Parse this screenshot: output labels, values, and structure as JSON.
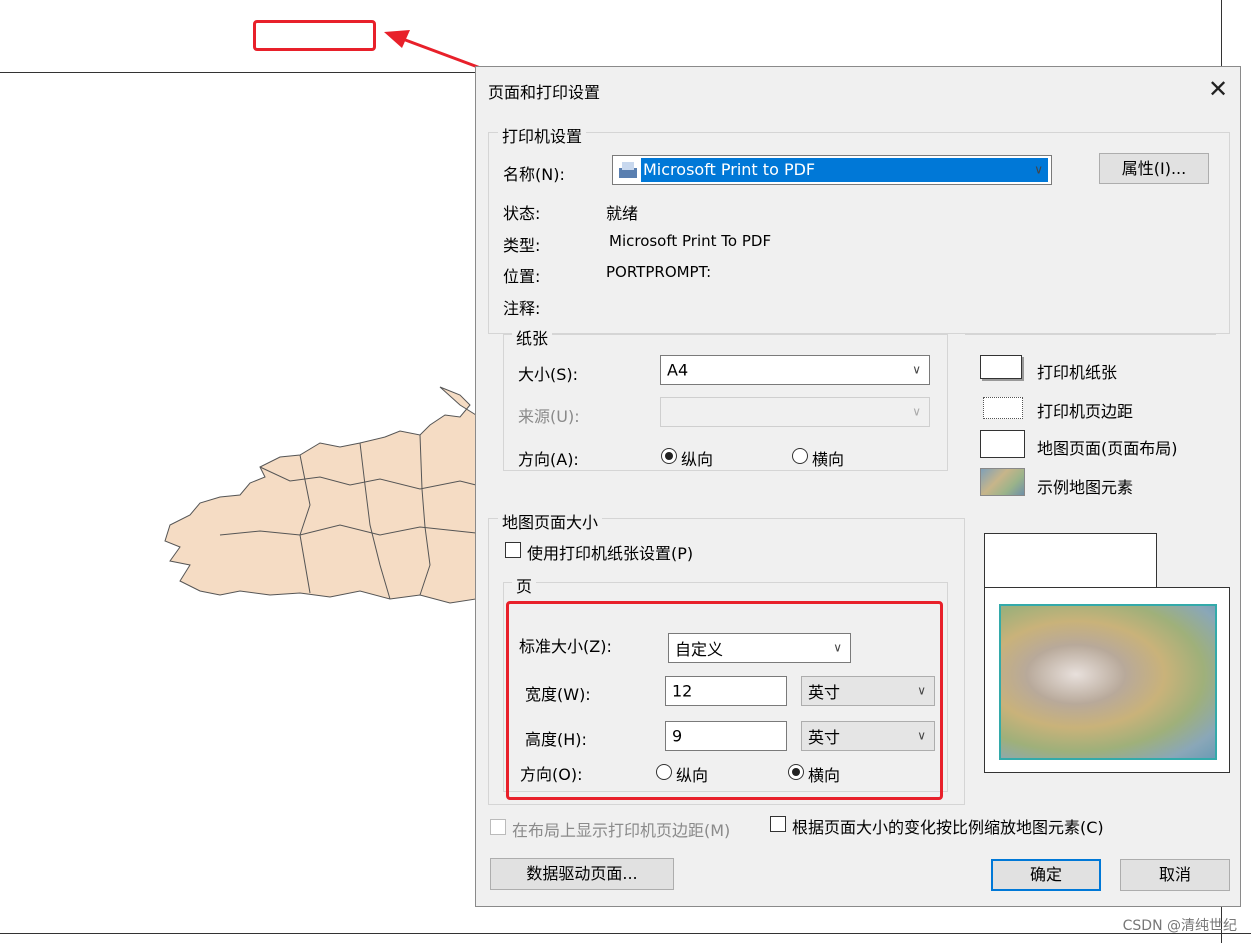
{
  "dialog": {
    "title": "页面和打印设置",
    "close_icon": "close-icon"
  },
  "printer": {
    "group_label": "打印机设置",
    "name_label": "名称(N):",
    "name_value": "Microsoft Print to PDF",
    "properties_button": "属性(I)...",
    "status_label": "状态:",
    "status_value": "就绪",
    "type_label": "类型:",
    "type_value": "Microsoft Print To PDF",
    "location_label": "位置:",
    "location_value": "PORTPROMPT:",
    "comment_label": "注释:"
  },
  "paper": {
    "group_label": "纸张",
    "size_label": "大小(S):",
    "size_value": "A4",
    "source_label": "来源(U):",
    "source_value": "",
    "orientation_label": "方向(A):",
    "portrait_label": "纵向",
    "landscape_label": "横向",
    "orientation_selected": "portrait"
  },
  "legend": {
    "items": [
      "打印机纸张",
      "打印机页边距",
      "地图页面(页面布局)",
      "示例地图元素"
    ]
  },
  "map_page": {
    "group_label": "地图页面大小",
    "use_printer_label": "使用打印机纸张设置(P)",
    "use_printer_checked": false,
    "page_group_label": "页",
    "standard_size_label": "标准大小(Z):",
    "standard_size_value": "自定义",
    "width_label": "宽度(W):",
    "width_value": "12",
    "width_unit": "英寸",
    "height_label": "高度(H):",
    "height_value": "9",
    "height_unit": "英寸",
    "orientation_label": "方向(O):",
    "portrait_label": "纵向",
    "landscape_label": "横向",
    "orientation_selected": "landscape"
  },
  "options": {
    "show_margins_label": "在布局上显示打印机页边距(M)",
    "show_margins_checked": false,
    "scale_elements_label": "根据页面大小的变化按比例缩放地图元素(C)",
    "scale_elements_checked": false
  },
  "buttons": {
    "data_driven": "数据驱动页面...",
    "ok": "确定",
    "cancel": "取消"
  },
  "colors": {
    "highlight": "#e8202a",
    "selection": "#0078d7",
    "map_fill": "#f5dcc4"
  },
  "watermark": "CSDN @清纯世纪"
}
